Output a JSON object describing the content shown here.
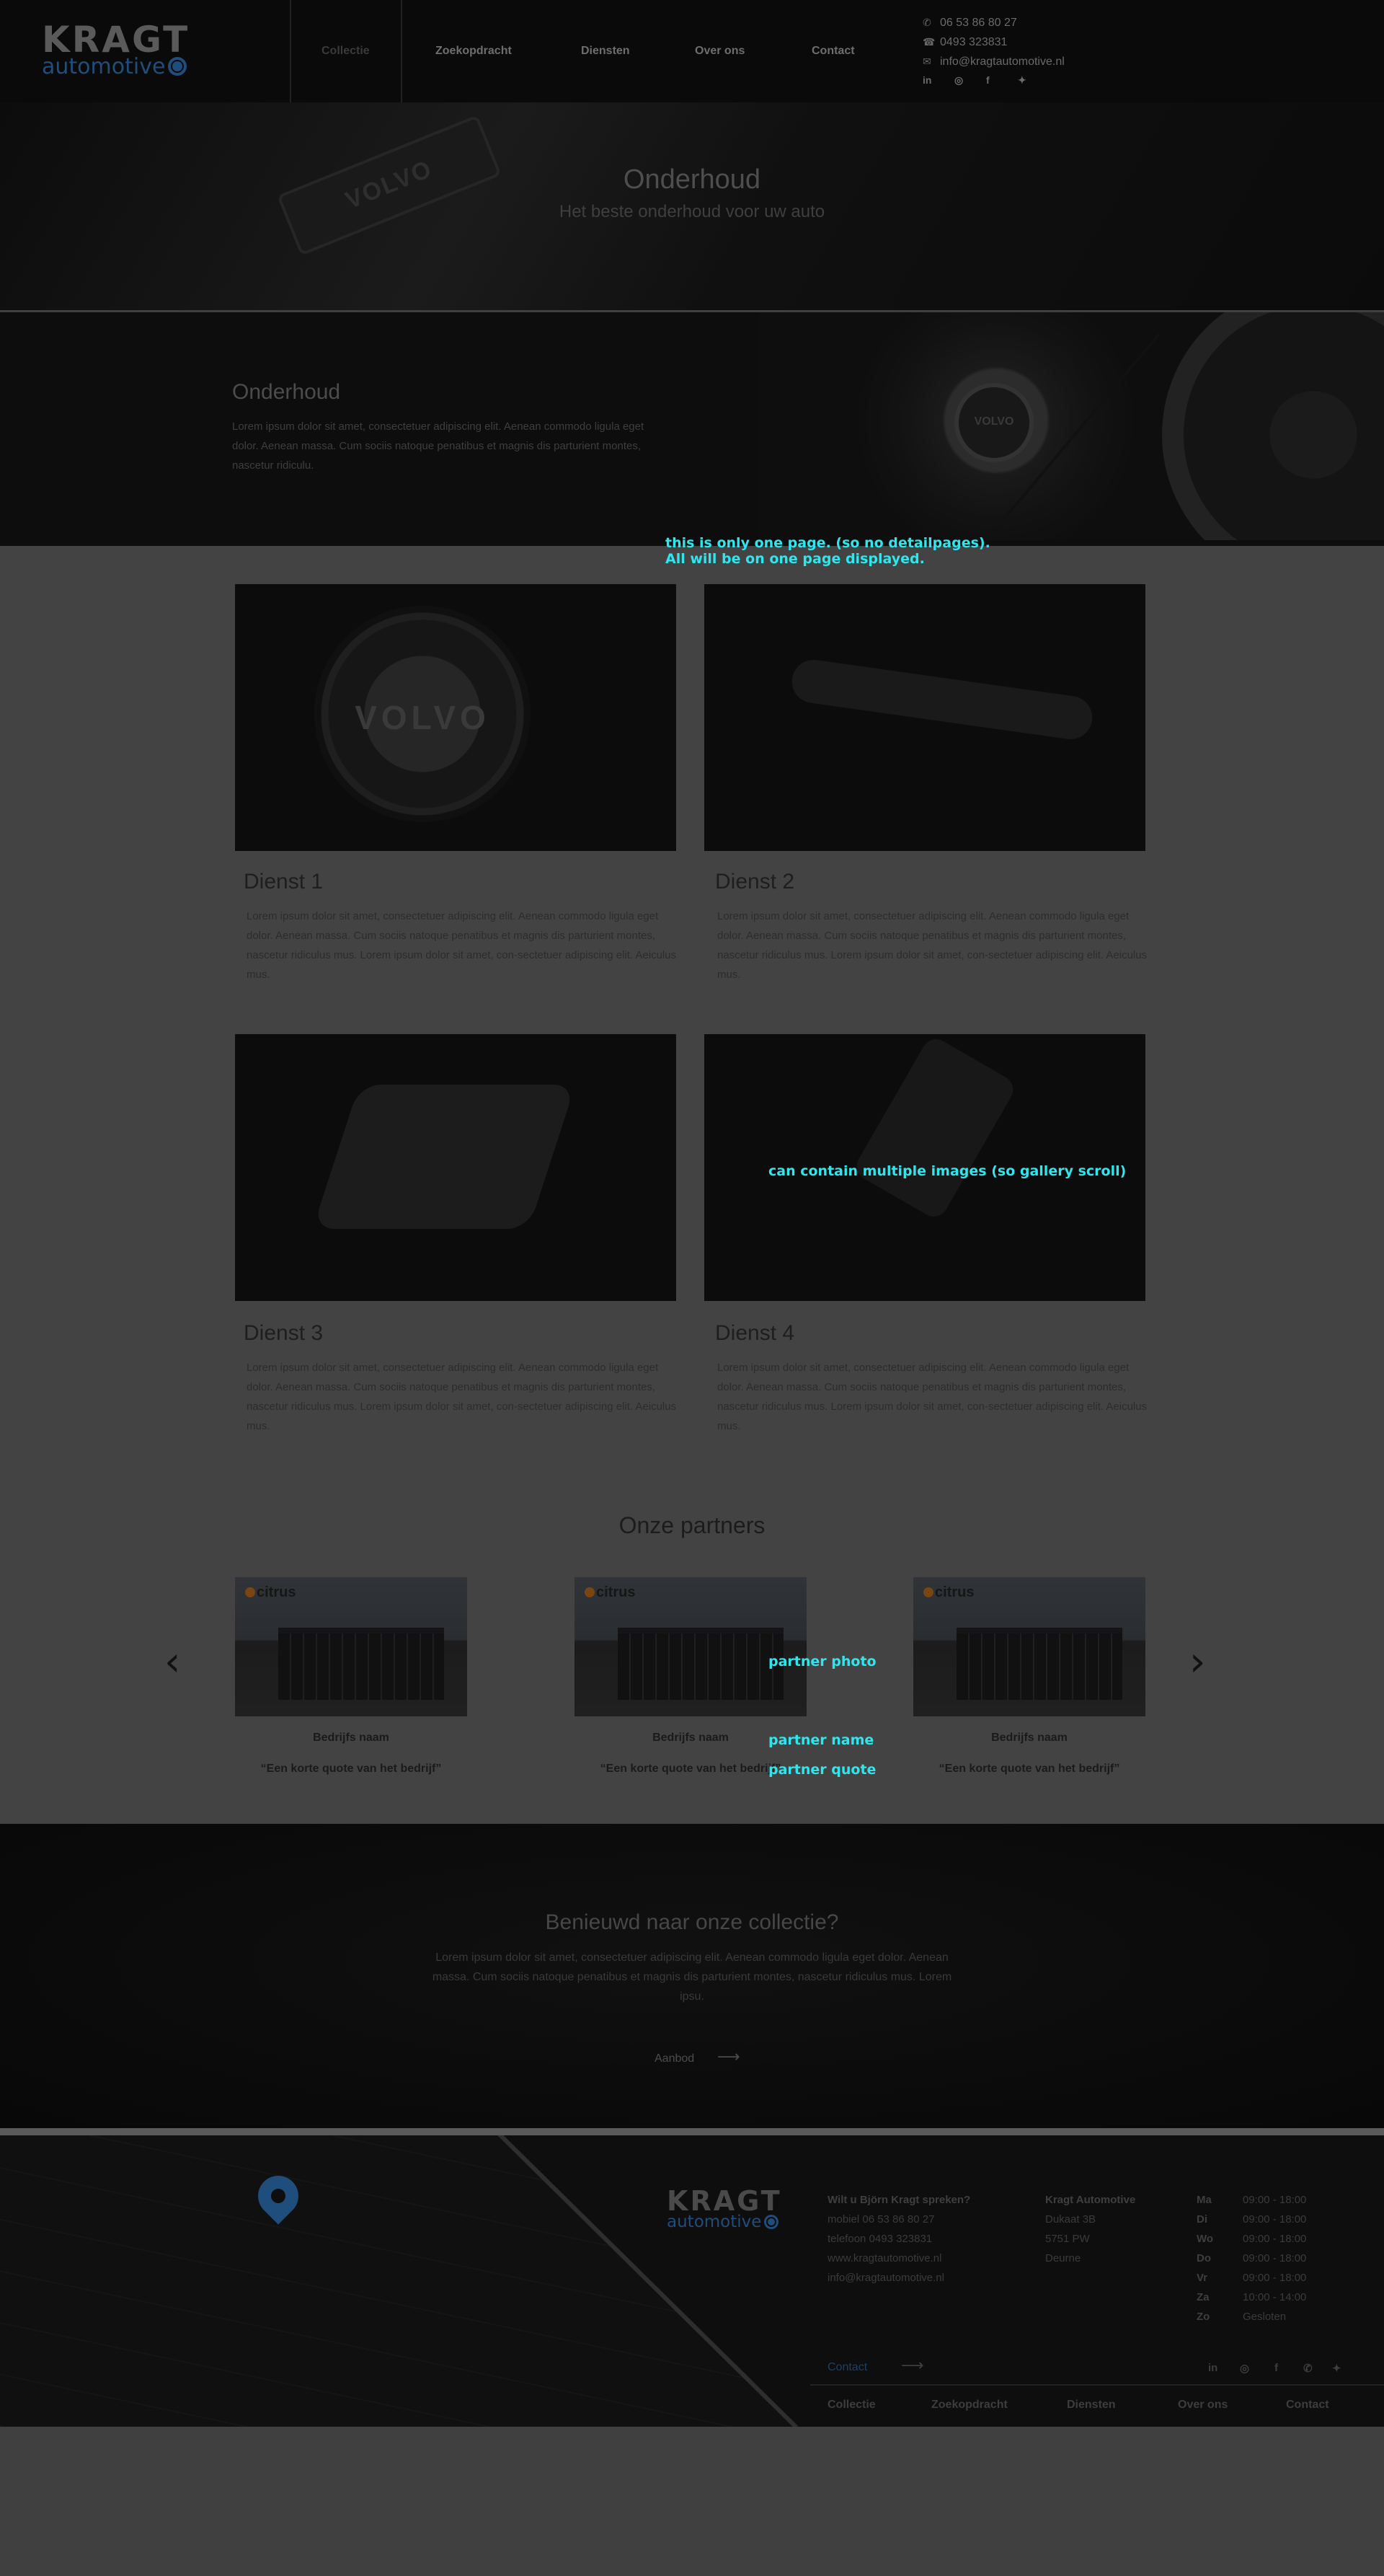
{
  "header": {
    "logo_main": "KRAGT",
    "logo_sub": "automotive",
    "nav": [
      "Collectie",
      "Zoekopdracht",
      "Diensten",
      "Over ons",
      "Contact"
    ],
    "contact": {
      "mobile": "06 53 86 80 27",
      "phone": "0493 323831",
      "email": "info@kragtautomotive.nl"
    },
    "social_icons": [
      "linkedin-icon",
      "instagram-icon",
      "facebook-icon",
      "twitter-icon"
    ]
  },
  "hero": {
    "title": "Onderhoud",
    "subtitle": "Het beste onderhoud voor uw auto"
  },
  "intro": {
    "title": "Onderhoud",
    "text": "Lorem ipsum dolor sit amet, consectetuer adipiscing elit. Aenean commodo ligula eget dolor. Aenean massa. Cum sociis natoque penatibus et magnis dis parturient montes, nascetur ridiculu."
  },
  "annotations": {
    "one_page_line1": "this is only one page. (so no detailpages).",
    "one_page_line2": "All will be on one page displayed.",
    "gallery": "can contain multiple images (so gallery scroll)",
    "partner_photo": "partner photo",
    "partner_name": "partner name",
    "partner_quote": "partner quote"
  },
  "services": [
    {
      "title": "Dienst 1",
      "text": "Lorem ipsum dolor sit amet, consectetuer adipiscing elit. Aenean commodo ligula eget dolor. Aenean massa. Cum sociis natoque penatibus et magnis dis parturient montes, nascetur ridiculus mus. Lorem ipsum dolor sit amet, con-sectetuer adipiscing elit. Aeiculus mus."
    },
    {
      "title": "Dienst 2",
      "text": "Lorem ipsum dolor sit amet, consectetuer adipiscing elit. Aenean commodo ligula eget dolor. Aenean massa. Cum sociis natoque penatibus et magnis dis parturient montes, nascetur ridiculus mus. Lorem ipsum dolor sit amet, con-sectetuer adipiscing elit. Aeiculus mus."
    },
    {
      "title": "Dienst 3",
      "text": "Lorem ipsum dolor sit amet, consectetuer adipiscing elit. Aenean commodo ligula eget dolor. Aenean massa. Cum sociis natoque penatibus et magnis dis parturient montes, nascetur ridiculus mus. Lorem ipsum dolor sit amet, con-sectetuer adipiscing elit. Aeiculus mus."
    },
    {
      "title": "Dienst 4",
      "text": "Lorem ipsum dolor sit amet, consectetuer adipiscing elit. Aenean commodo ligula eget dolor. Aenean massa. Cum sociis natoque penatibus et magnis dis parturient montes, nascetur ridiculus mus. Lorem ipsum dolor sit amet, con-sectetuer adipiscing elit. Aeiculus mus."
    }
  ],
  "partners": {
    "title": "Onze partners",
    "items": [
      {
        "logo": "citrus",
        "name": "Bedrijfs naam",
        "quote": "“Een korte quote  van het bedrijf”"
      },
      {
        "logo": "citrus",
        "name": "Bedrijfs naam",
        "quote": "“Een korte quote  van het bedrijf”"
      },
      {
        "logo": "citrus",
        "name": "Bedrijfs naam",
        "quote": "“Een korte quote  van het bedrijf”"
      }
    ]
  },
  "cta": {
    "title": "Benieuwd naar onze collectie?",
    "text": "Lorem ipsum dolor sit amet, consectetuer adipiscing elit. Aenean commodo ligula eget dolor. Aenean massa. Cum sociis natoque penatibus et magnis dis parturient montes, nascetur ridiculus mus. Lorem ipsu.",
    "button": "Aanbod"
  },
  "footer": {
    "logo_main": "KRAGT",
    "logo_sub": "automotive",
    "col1": {
      "head": "Wilt u Björn Kragt spreken?",
      "lines": [
        "mobiel 06 53 86 80 27",
        "telefoon 0493 323831",
        "www.kragtautomotive.nl",
        "info@kragtautomotive.nl"
      ]
    },
    "col2": {
      "head": "Kragt Automotive",
      "lines": [
        "Dukaat 3B",
        "5751 PW",
        "Deurne"
      ]
    },
    "hours": [
      {
        "day": "Ma",
        "time": "09:00 - 18:00"
      },
      {
        "day": "Di",
        "time": "09:00 - 18:00"
      },
      {
        "day": "Wo",
        "time": "09:00 - 18:00"
      },
      {
        "day": "Do",
        "time": "09:00 - 18:00"
      },
      {
        "day": "Vr",
        "time": "09:00 - 18:00"
      },
      {
        "day": "Za",
        "time": "10:00 - 14:00"
      },
      {
        "day": "Zo",
        "time": "Gesloten"
      }
    ],
    "contact_link": "Contact",
    "nav": [
      "Collectie",
      "Zoekopdracht",
      "Diensten",
      "Over ons",
      "Contact"
    ],
    "social_icons": [
      "linkedin-icon",
      "instagram-icon",
      "facebook-icon",
      "whatsapp-icon",
      "twitter-icon"
    ]
  },
  "colors": {
    "brand_blue": "#1f4d7c",
    "annotation_cyan": "#2ee7ee"
  }
}
